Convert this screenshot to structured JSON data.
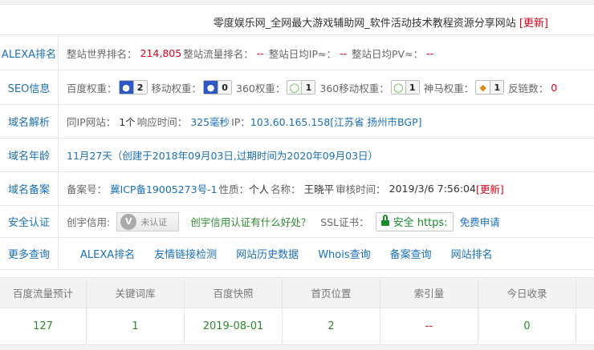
{
  "site": {
    "title": "零度娱乐网_全网最大游戏辅助网_软件活动技术教程资源分享网站",
    "update": "[更新]"
  },
  "alexa": {
    "label": "ALEXA排名",
    "world_rank_label": "整站世界排名：",
    "world_rank": "214,805",
    "traffic_rank_label": "整站流量排名：",
    "traffic_rank": "--",
    "daily_ip_label": "整站日均IP≈：",
    "daily_ip": "--",
    "daily_pv_label": "整站日均PV≈：",
    "daily_pv": "--"
  },
  "seo": {
    "label": "SEO信息",
    "baidu_label": "百度权重：",
    "baidu_value": "2",
    "mobile_label": "移动权重：",
    "mobile_value": "0",
    "s360_label": "360权重：",
    "s360_value": "1",
    "s360m_label": "360移动权重：",
    "s360m_value": "1",
    "shenma_label": "神马权重：",
    "shenma_value": "1",
    "backlinks_label": "反链数：",
    "backlinks_value": "0",
    "icon_baidu": "paw-icon",
    "icon_360": "360-icon",
    "icon_shenma": "shenma-icon"
  },
  "dns": {
    "label": "域名解析",
    "same_ip_label": "同IP网站：",
    "same_ip_value": "1个",
    "response_label": "响应时间：",
    "response_value": "325毫秒",
    "ip_label": "IP：",
    "ip_value": "103.60.165.158[江苏省 扬州市BGP]"
  },
  "age": {
    "label": "域名年龄",
    "value": "11月27天（创建于2018年09月03日,过期时间为2020年09月03日）"
  },
  "icp": {
    "label": "域名备案",
    "number_label": "备案号：",
    "number": "冀ICP备19005273号-1",
    "nature_label": "性质：",
    "nature": "个人",
    "name_label": "名称：",
    "name": "王晓平",
    "audit_label": "审核时间：",
    "audit": "2019/3/6 7:56:04",
    "update": "[更新]"
  },
  "security": {
    "label": "安全认证",
    "credit_label": "创宇信用:",
    "unverified": "未认证",
    "v_mark": "V",
    "benefit_link": "创宇信用认证有什么好处？",
    "ssl_label": "SSL证书：",
    "ssl_badge": "安全 https:",
    "apply_link": "免费申请"
  },
  "more": {
    "label": "更多查询",
    "links": [
      "ALEXA排名",
      "友情链接检测",
      "网站历史数据",
      "Whois查询",
      "备案查询",
      "网站排名"
    ]
  },
  "stats": {
    "headers": [
      "百度流量预计",
      "关键词库",
      "百度快照",
      "首页位置",
      "索引量",
      "今日收录"
    ],
    "values": [
      "127",
      "1",
      "2019-08-01",
      "2",
      "--",
      "0"
    ]
  },
  "colors": {
    "link": "#1a6fb7",
    "accent_red": "#d9001b",
    "green": "#2d8a2d"
  }
}
